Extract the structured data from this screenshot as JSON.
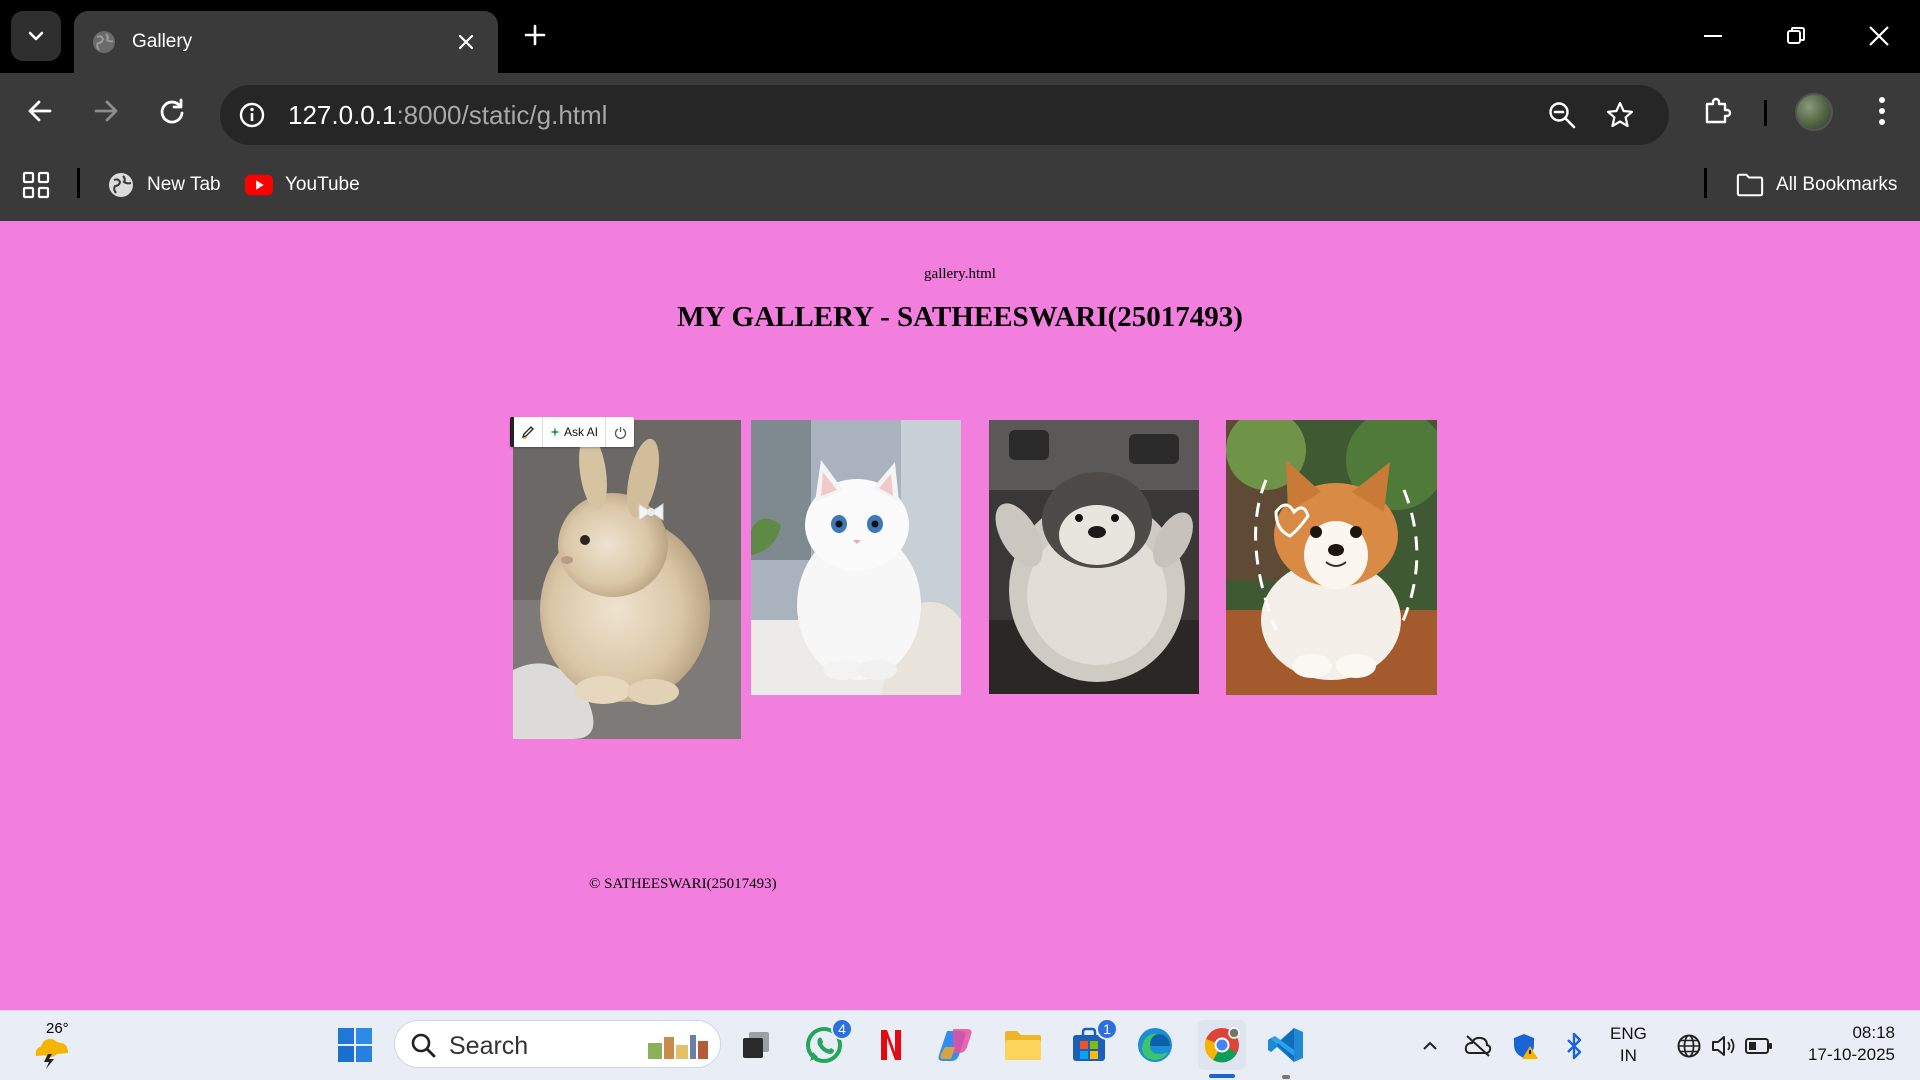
{
  "browser": {
    "tab": {
      "title": "Gallery",
      "favicon": "globe-icon"
    },
    "address": {
      "host": "127.0.0.1",
      "rest": ":8000/static/g.html"
    },
    "bookmarks": [
      {
        "label": "New Tab",
        "icon": "globe-icon"
      },
      {
        "label": "YouTube",
        "icon": "youtube-icon"
      }
    ],
    "all_bookmarks_label": "All Bookmarks"
  },
  "page": {
    "background": "#f27ede",
    "file_label": "gallery.html",
    "heading": "MY GALLERY - SATHEESWARI(25017493)",
    "photos": [
      {
        "subject": "bunny-photo"
      },
      {
        "subject": "white-cat-photo"
      },
      {
        "subject": "penguin-chick-photo"
      },
      {
        "subject": "corgi-puppy-photo"
      }
    ],
    "footer": "© SATHEESWARI(25017493)",
    "ai_toolbar": {
      "ask_label": "Ask AI"
    }
  },
  "taskbar": {
    "weather_temp": "26°",
    "search_placeholder": "Search",
    "whatsapp_badge": "4",
    "store_badge": "1",
    "lang_line1": "ENG",
    "lang_line2": "IN",
    "time": "08:18",
    "date": "17-10-2025"
  },
  "colors": {
    "accent_blue": "#1a64d6",
    "youtube_red": "#ff0000",
    "page_pink": "#f27ede"
  }
}
